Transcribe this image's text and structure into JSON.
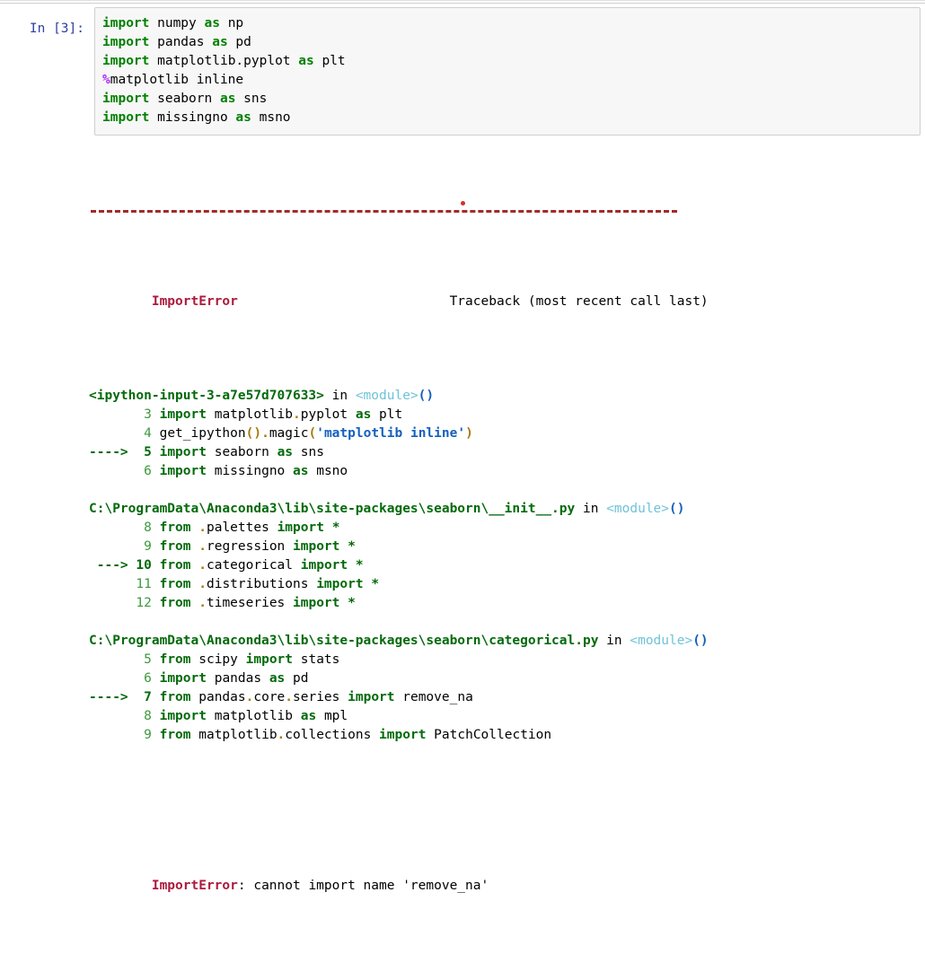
{
  "notebook": {
    "input_prompt": "In [3]:",
    "code_lines": [
      {
        "segments": [
          {
            "t": "import",
            "c": "kw"
          },
          {
            "t": " numpy ",
            "c": "plain"
          },
          {
            "t": "as",
            "c": "kw"
          },
          {
            "t": " np",
            "c": "plain"
          }
        ]
      },
      {
        "segments": [
          {
            "t": "import",
            "c": "kw"
          },
          {
            "t": " pandas ",
            "c": "plain"
          },
          {
            "t": "as",
            "c": "kw"
          },
          {
            "t": " pd",
            "c": "plain"
          }
        ]
      },
      {
        "segments": [
          {
            "t": "import",
            "c": "kw"
          },
          {
            "t": " matplotlib.pyplot ",
            "c": "plain"
          },
          {
            "t": "as",
            "c": "kw"
          },
          {
            "t": " plt",
            "c": "plain"
          }
        ]
      },
      {
        "segments": [
          {
            "t": "%",
            "c": "magic"
          },
          {
            "t": "matplotlib inline",
            "c": "plain"
          }
        ]
      },
      {
        "segments": [
          {
            "t": "import",
            "c": "kw"
          },
          {
            "t": " seaborn ",
            "c": "plain"
          },
          {
            "t": "as",
            "c": "kw"
          },
          {
            "t": " sns",
            "c": "plain"
          }
        ]
      },
      {
        "segments": [
          {
            "t": "import",
            "c": "kw"
          },
          {
            "t": " missingno ",
            "c": "plain"
          },
          {
            "t": "as",
            "c": "kw"
          },
          {
            "t": " msno",
            "c": "plain"
          }
        ]
      }
    ],
    "code_plain": [
      "import numpy as np",
      "import pandas as pd",
      "import matplotlib.pyplot as plt",
      "%matplotlib inline",
      "import seaborn as sns",
      "import missingno as msno"
    ]
  },
  "traceback": {
    "separator_dashes": "---------------------------------------------------------------------------",
    "error_name": "ImportError",
    "traceback_header": "Traceback (most recent call last)",
    "frames": [
      {
        "location": "<ipython-input-3-a7e57d707633>",
        "in_word": "in",
        "scope": "<module>",
        "scope_parens": "()",
        "lines": [
          {
            "marker": "",
            "no": "3",
            "highlight": false,
            "text": "import matplotlib.pyplot as plt"
          },
          {
            "marker": "",
            "no": "4",
            "highlight": false,
            "text": "get_ipython().magic('matplotlib inline')"
          },
          {
            "marker": "---->",
            "no": "5",
            "highlight": true,
            "text": "import seaborn as sns"
          },
          {
            "marker": "",
            "no": "6",
            "highlight": false,
            "text": "import missingno as msno"
          }
        ]
      },
      {
        "location": "C:\\ProgramData\\Anaconda3\\lib\\site-packages\\seaborn\\__init__.py",
        "in_word": "in",
        "scope": "<module>",
        "scope_parens": "()",
        "lines": [
          {
            "marker": "",
            "no": "8",
            "highlight": false,
            "text": "from .palettes import *"
          },
          {
            "marker": "",
            "no": "9",
            "highlight": false,
            "text": "from .regression import *"
          },
          {
            "marker": "--->",
            "no": "10",
            "highlight": true,
            "text": "from .categorical import *"
          },
          {
            "marker": "",
            "no": "11",
            "highlight": false,
            "text": "from .distributions import *"
          },
          {
            "marker": "",
            "no": "12",
            "highlight": false,
            "text": "from .timeseries import *"
          }
        ]
      },
      {
        "location": "C:\\ProgramData\\Anaconda3\\lib\\site-packages\\seaborn\\categorical.py",
        "in_word": "in",
        "scope": "<module>",
        "scope_parens": "()",
        "lines": [
          {
            "marker": "",
            "no": "5",
            "highlight": false,
            "text": "from scipy import stats"
          },
          {
            "marker": "",
            "no": "6",
            "highlight": false,
            "text": "import pandas as pd"
          },
          {
            "marker": "---->",
            "no": "7",
            "highlight": true,
            "text": "from pandas.core.series import remove_na"
          },
          {
            "marker": "",
            "no": "8",
            "highlight": false,
            "text": "import matplotlib as mpl"
          },
          {
            "marker": "",
            "no": "9",
            "highlight": false,
            "text": "from matplotlib.collections import PatchCollection"
          }
        ]
      }
    ],
    "final_error_name": "ImportError",
    "final_error_message": ": cannot import name 'remove_na'"
  },
  "colors": {
    "error_red": "#AD1A3C",
    "separator_red": "#A02B2B",
    "dot_red": "#D32F2F",
    "keyword_green": "#008000",
    "file_green": "#046A0B",
    "lineno_green": "#3C9A3C",
    "module_cyan": "#6FC3D8",
    "paren_blue": "#1560BD",
    "gold": "#A67B10",
    "magic_purple": "#AA22FF",
    "prompt_blue": "#303F9F",
    "cell_bg": "#f7f7f7",
    "cell_border": "#cfcfcf"
  }
}
